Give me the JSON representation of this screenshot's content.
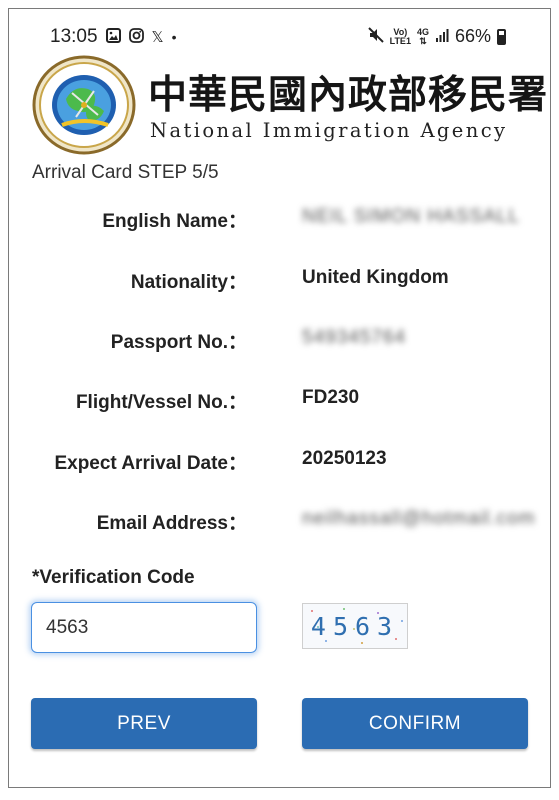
{
  "status_bar": {
    "time": "13:05",
    "left_icons": [
      "gallery-icon",
      "instagram-icon",
      "x-icon",
      "dot"
    ],
    "x_glyph": "𝕏",
    "dot_glyph": "•",
    "volte_top": "Vo)",
    "volte_bottom": "LTE1",
    "network": "4G",
    "battery": "66%"
  },
  "header": {
    "agency_name_cn": "中華民國內政部移民署",
    "agency_name_en": "National Immigration Agency"
  },
  "step_title": "Arrival Card STEP 5/5",
  "fields": [
    {
      "label": "English Name：",
      "value": "NEIL SIMON HASSALL",
      "blurred": true
    },
    {
      "label": "Nationality：",
      "value": "United Kingdom",
      "blurred": false
    },
    {
      "label": "Passport No.：",
      "value": "549345764",
      "blurred": true
    },
    {
      "label": "Flight/Vessel No.：",
      "value": "FD230",
      "blurred": false
    },
    {
      "label": "Expect Arrival Date：",
      "value": "20250123",
      "blurred": false
    },
    {
      "label": "Email Address：",
      "value": "neilhassall@hotmail.com",
      "blurred": true
    }
  ],
  "verification": {
    "label": "*Verification Code",
    "input_value": "4563",
    "captcha_text": "4563"
  },
  "buttons": {
    "prev": "PREV",
    "confirm": "CONFIRM"
  },
  "colors": {
    "button_bg": "#2b6cb3",
    "input_focus": "#4a90e2",
    "captcha_text": "#2f6fb0"
  }
}
